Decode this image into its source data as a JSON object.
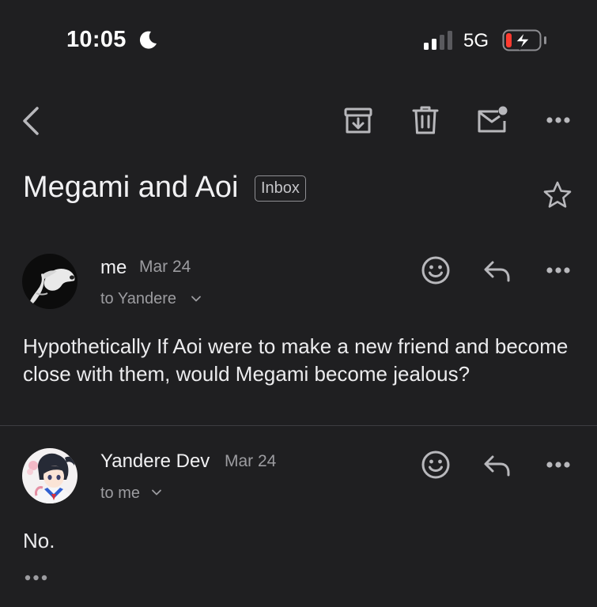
{
  "status_bar": {
    "time": "10:05",
    "network": "5G",
    "battery_level": 0.15
  },
  "toolbar": {
    "icons": [
      "back-icon",
      "archive-icon",
      "trash-icon",
      "mark-unread-icon",
      "more-icon"
    ]
  },
  "thread": {
    "subject": "Megami and Aoi",
    "label": "Inbox",
    "starred": false
  },
  "messages": [
    {
      "sender": "me",
      "date": "Mar 24",
      "recipient": "to Yandere",
      "body": "Hypothetically If Aoi were to make a new friend and become close with them, would Megami become jealous?"
    },
    {
      "sender": "Yandere Dev",
      "date": "Mar 24",
      "recipient": "to me",
      "body": "No."
    }
  ],
  "colors": {
    "background": "#1f1f21",
    "text": "#e8e8ea",
    "muted": "#9c9ca0",
    "icon": "#b8b8bc",
    "battery_low": "#ff3b30"
  }
}
